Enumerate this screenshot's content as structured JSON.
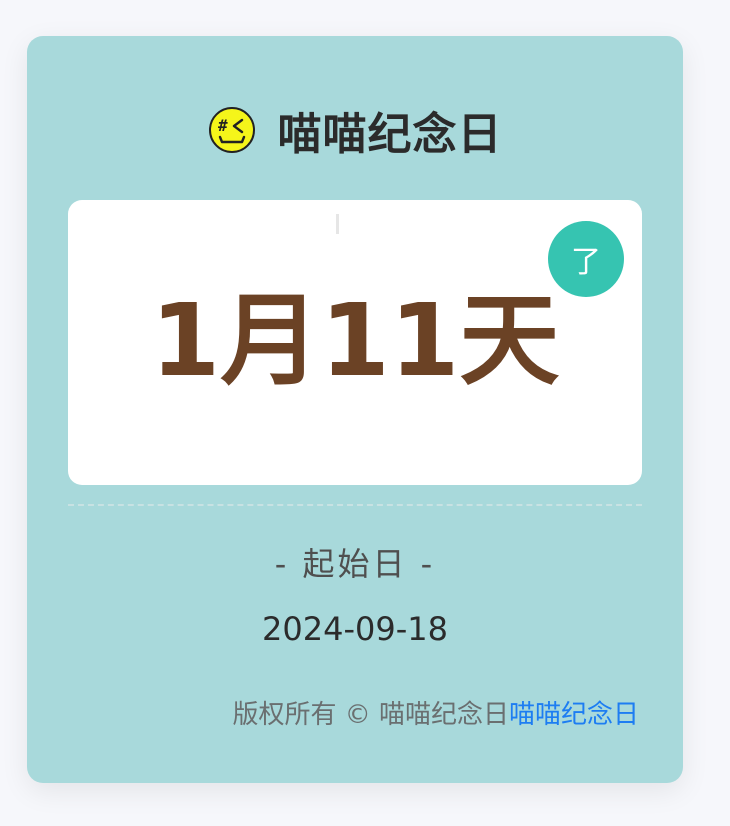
{
  "header": {
    "title": "喵喵纪念日",
    "emoji_icon": "wink-face-icon",
    "emoji_color": "#f5f51a"
  },
  "counter": {
    "value": "1月11天",
    "badge_text": "了",
    "value_color": "#6b4225",
    "badge_color": "#36c4b1"
  },
  "start": {
    "label": "- 起始日 -",
    "date": "2024-09-18"
  },
  "footer": {
    "copyright": "版权所有 © 喵喵纪念日",
    "link_text": "喵喵纪念日",
    "link_color": "#1d7df2"
  },
  "colors": {
    "card_background": "#a8d9db",
    "page_background": "#f6f7fb"
  }
}
